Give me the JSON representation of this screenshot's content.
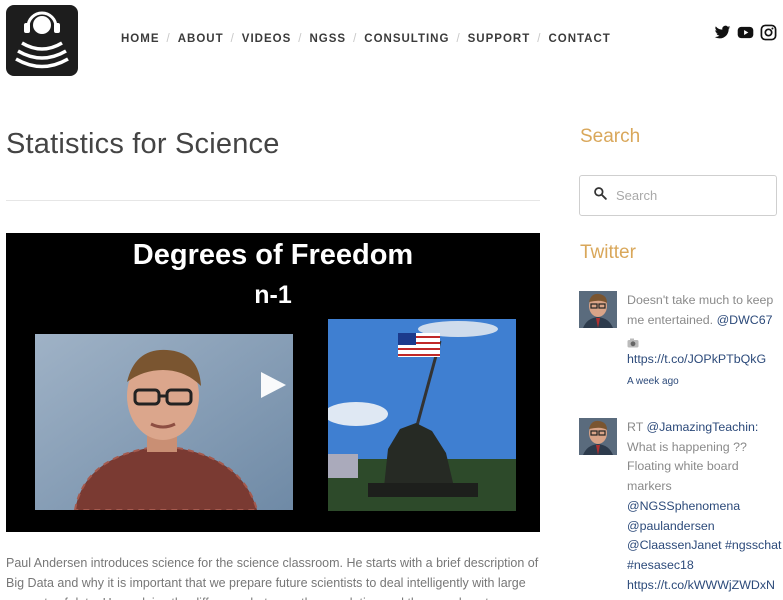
{
  "nav": {
    "items": [
      "HOME",
      "ABOUT",
      "VIDEOS",
      "NGSS",
      "CONSULTING",
      "SUPPORT",
      "CONTACT"
    ]
  },
  "social": [
    "twitter-icon",
    "youtube-icon",
    "instagram-icon"
  ],
  "page": {
    "title": "Statistics for Science"
  },
  "video": {
    "title_line1": "Degrees of Freedom",
    "title_line2": "n-1"
  },
  "description": "Paul Andersen introduces science for the science classroom. He starts with a brief description of Big Data and why it is important that we prepare future scientists to deal intelligently with large amounts of data. He explains the difference between the population and the sample set.",
  "sidebar": {
    "search_heading": "Search",
    "search_placeholder": "Search",
    "twitter_heading": "Twitter",
    "tweets": [
      {
        "text": "Doesn't take much to keep me entertained.",
        "mention": "@DWC67",
        "link": "https://t.co/JOPkPTbQkG",
        "time": "A week ago"
      },
      {
        "prefix": "RT",
        "mention1": "@JamazingTeachin:",
        "text": "What is happening ?? Floating white board markers",
        "mention2": "@NGSSphenomena",
        "mention3": "@paulandersen",
        "mention4": "@ClaassenJanet #ngsschat #nesasec18",
        "link": "https://t.co/kWWWjZWDxN"
      }
    ]
  },
  "colors": {
    "accent": "#d9a75a",
    "link": "#2c4a7a"
  }
}
